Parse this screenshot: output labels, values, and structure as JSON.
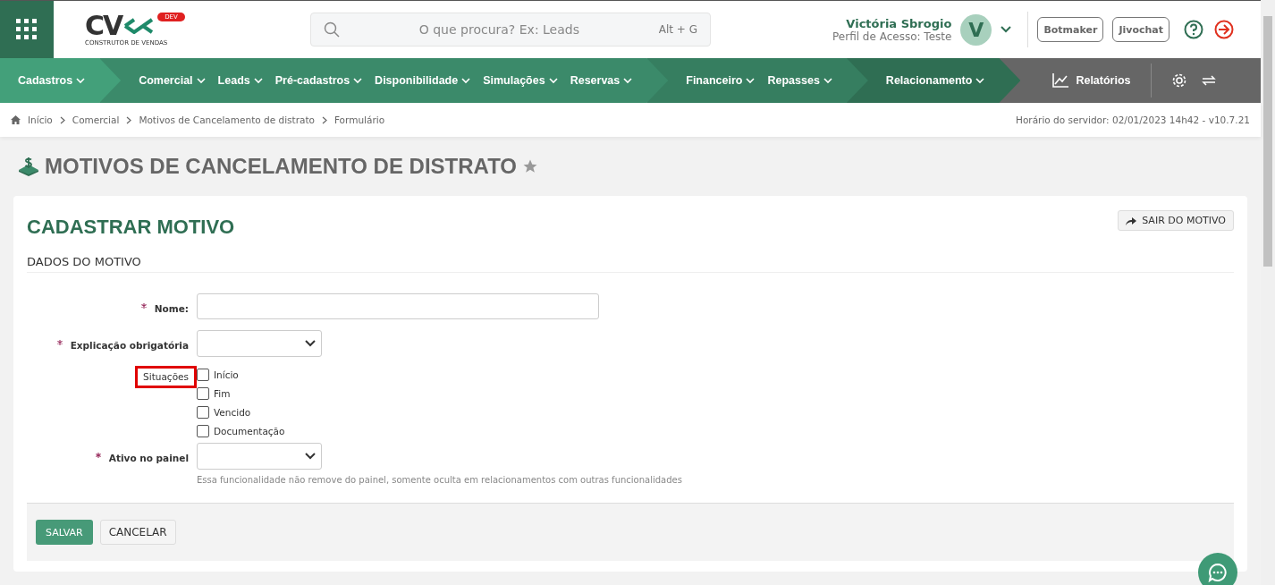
{
  "header": {
    "logo": {
      "letters": "CV",
      "badge": "DEV",
      "tagline": "CONSTRUTOR DE VENDAS"
    },
    "search": {
      "placeholder": "O que procura? Ex: Leads",
      "shortcut": "Alt + G"
    },
    "user": {
      "name": "Victória Sbrogio",
      "profile": "Perfil de Acesso: Teste",
      "initial": "V"
    },
    "buttons": [
      "Botmaker",
      "Jivochat"
    ]
  },
  "nav": {
    "groups": [
      {
        "color": "#43a07a",
        "items": [
          "Cadastros"
        ]
      },
      {
        "color": "#3b8a6a",
        "items": [
          "Comercial",
          "Leads",
          "Pré-cadastros",
          "Disponibilidade",
          "Simulações",
          "Reservas"
        ]
      },
      {
        "color": "#367e60",
        "items": [
          "Financeiro",
          "Repasses"
        ]
      },
      {
        "color": "#2f6e53",
        "items": [
          "Relacionamento"
        ]
      }
    ],
    "reports": "Relatórios"
  },
  "breadcrumb": [
    "Início",
    "Comercial",
    "Motivos de Cancelamento de distrato",
    "Formulário"
  ],
  "server_time": "Horário do servidor: 02/01/2023 14h42 - v10.7.21",
  "page_title": "MOTIVOS DE CANCELAMENTO DE DISTRATO",
  "card": {
    "title": "CADASTRAR MOTIVO",
    "exit_button": "SAIR DO MOTIVO",
    "section": "DADOS DO MOTIVO",
    "fields": [
      {
        "kind": "text",
        "label": "Nome:",
        "required": true,
        "highlighted": false
      },
      {
        "kind": "select",
        "label": "Explicação obrigatória",
        "required": true,
        "highlighted": false
      },
      {
        "kind": "checks",
        "label": "Situações",
        "highlighted": true,
        "options": [
          {
            "label": "Início",
            "checked": false
          },
          {
            "label": "Fim",
            "checked": false
          },
          {
            "label": "Vencido",
            "checked": false
          },
          {
            "label": "Documentação",
            "checked": false
          }
        ]
      },
      {
        "kind": "select",
        "label": "Ativo no painel",
        "required": true,
        "highlighted": false,
        "help": "Essa funcionalidade não remove do painel, somente oculta em relacionamentos com outras funcionalidades"
      }
    ],
    "save": "SALVAR",
    "cancel": "CANCELAR"
  }
}
